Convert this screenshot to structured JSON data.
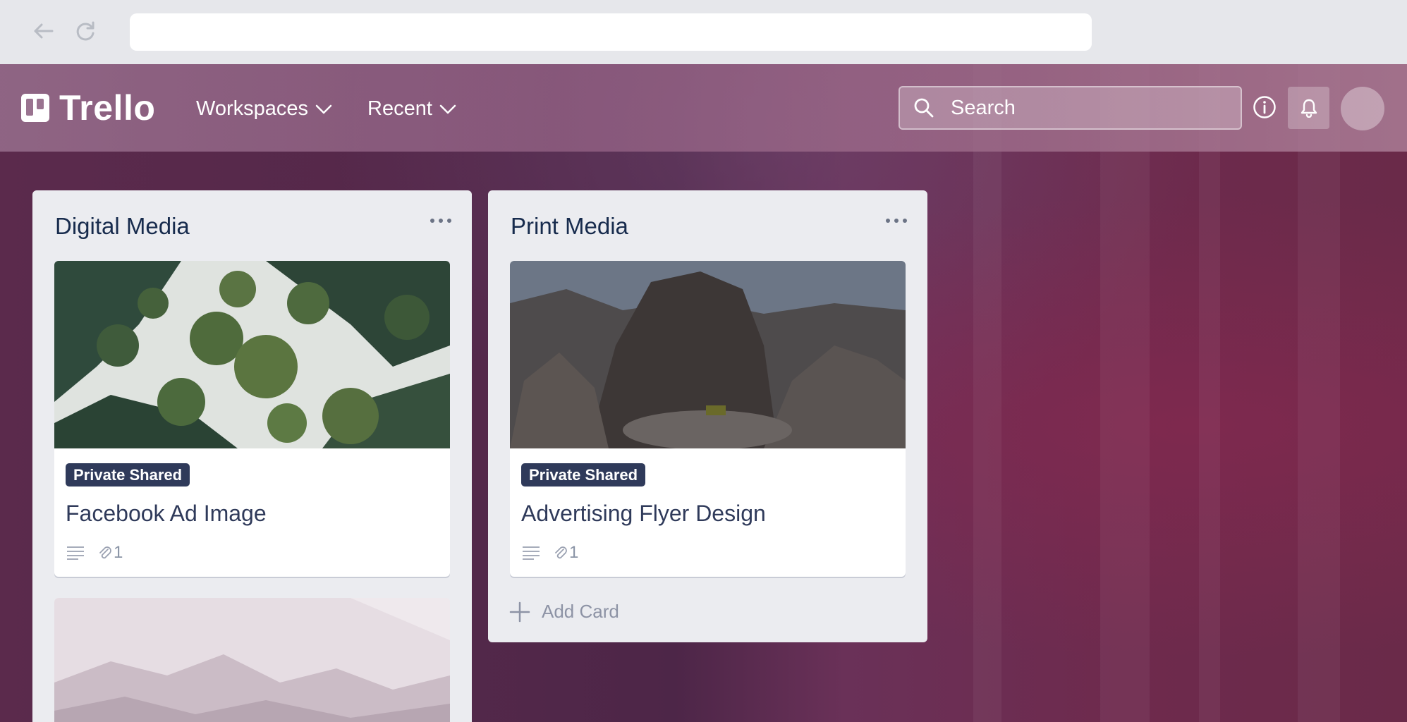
{
  "header": {
    "brand": "Trello",
    "nav": [
      {
        "label": "Workspaces"
      },
      {
        "label": "Recent"
      }
    ],
    "search": {
      "placeholder": "Search"
    }
  },
  "lists": [
    {
      "title": "Digital Media",
      "cards": [
        {
          "label": "Private Shared",
          "title": "Facebook Ad Image",
          "attachments": "1"
        }
      ]
    },
    {
      "title": "Print Media",
      "cards": [
        {
          "label": "Private Shared",
          "title": "Advertising Flyer Design",
          "attachments": "1"
        }
      ],
      "add_card_label": "Add Card"
    }
  ],
  "colors": {
    "label_badge": "#2f3a5a",
    "list_bg": "#ebecf0",
    "title_text": "#172b4d"
  }
}
